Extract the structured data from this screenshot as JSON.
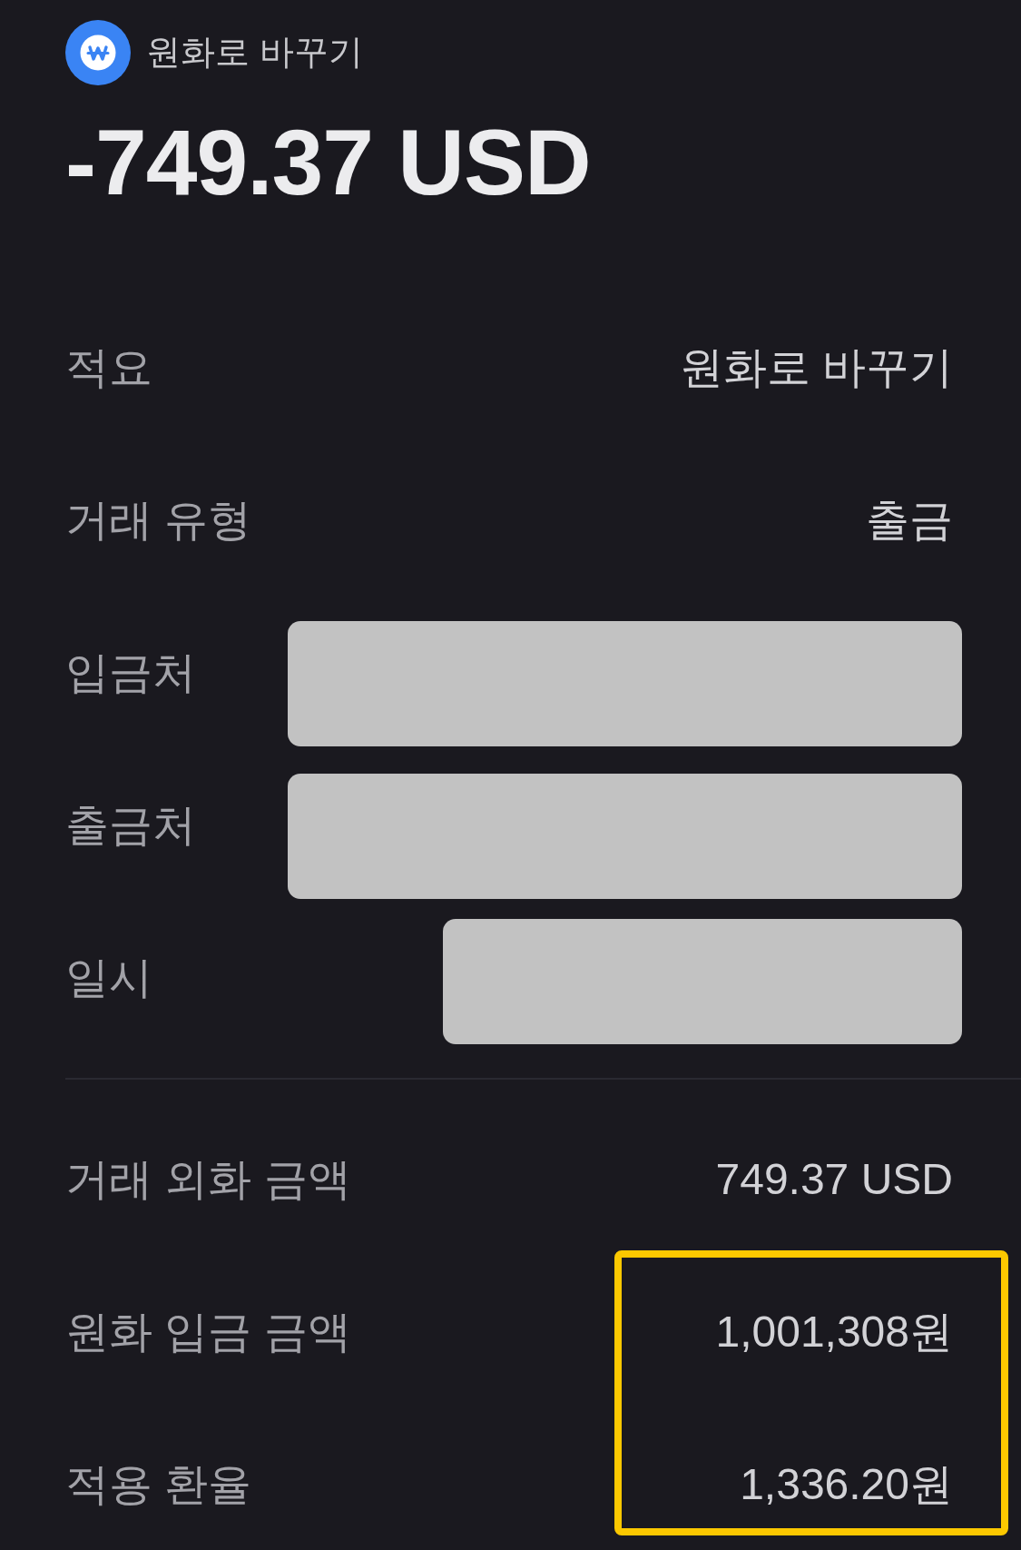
{
  "header": {
    "title": "원화로 바꾸기",
    "amount": "-749.37 USD"
  },
  "details": [
    {
      "label": "적요",
      "value": "원화로 바꾸기",
      "redacted": false
    },
    {
      "label": "거래 유형",
      "value": "출금",
      "redacted": false
    },
    {
      "label": "입금처",
      "redacted": true
    },
    {
      "label": "출금처",
      "redacted": true
    },
    {
      "label": "일시",
      "redacted": true
    }
  ],
  "amounts": [
    {
      "label": "거래 외화 금액",
      "value": "749.37 USD",
      "highlighted": false
    },
    {
      "label": "원화 입금 금액",
      "value": "1,001,308원",
      "highlighted": true
    },
    {
      "label": "적용 환율",
      "value": "1,336.20원",
      "highlighted": true
    }
  ]
}
